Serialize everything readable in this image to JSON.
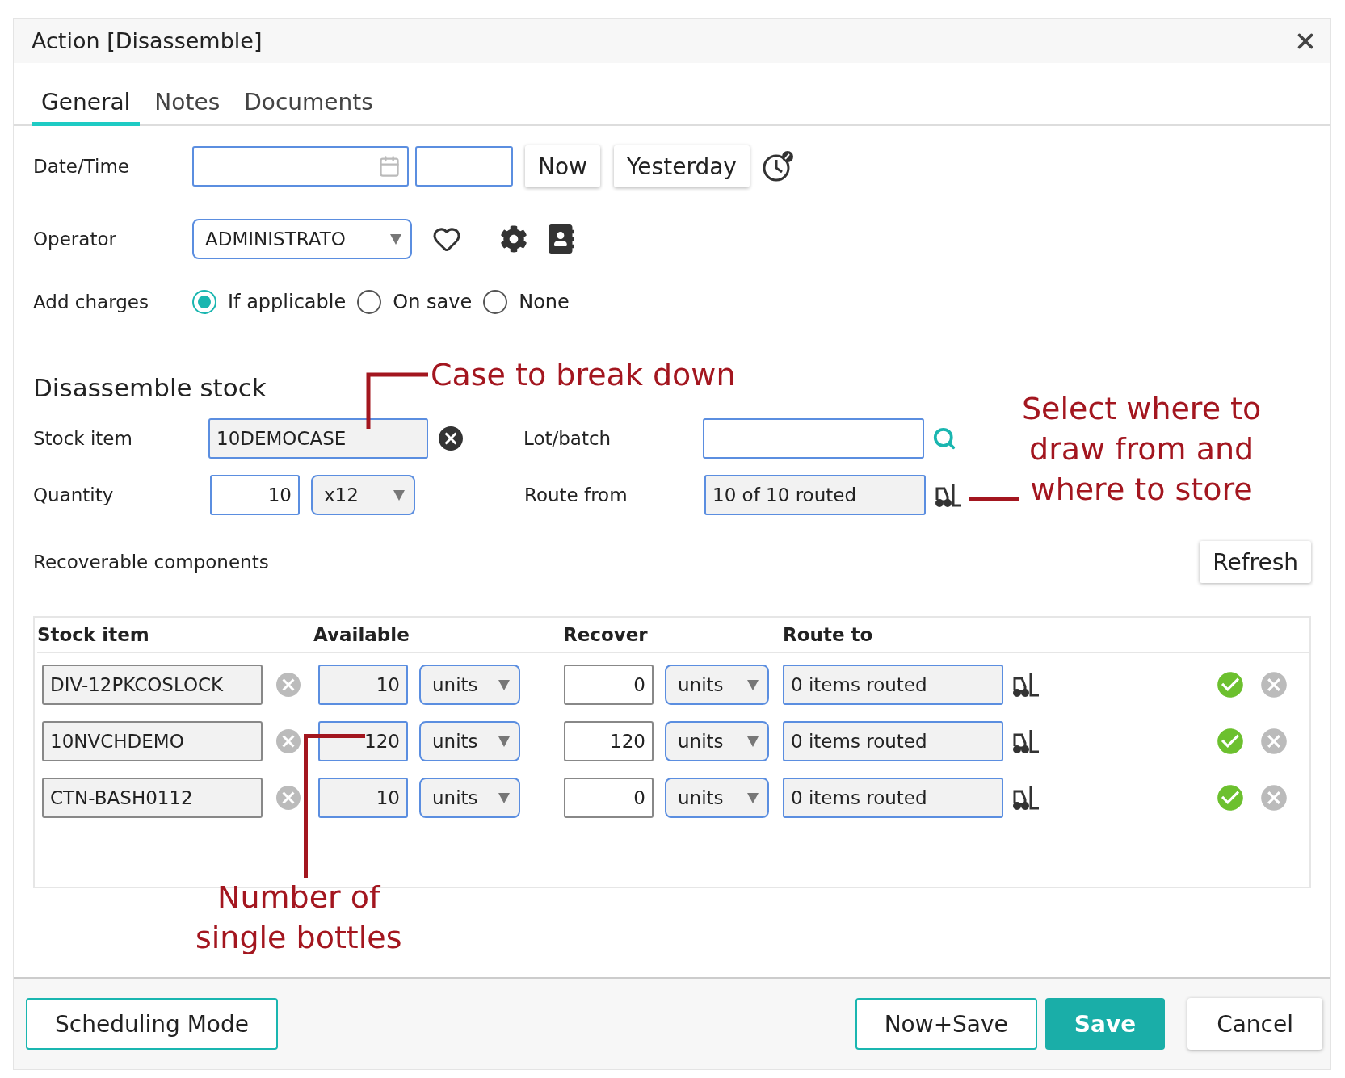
{
  "dialog": {
    "title": "Action [Disassemble]"
  },
  "tabs": [
    {
      "label": "General",
      "selected": true
    },
    {
      "label": "Notes",
      "selected": false
    },
    {
      "label": "Documents",
      "selected": false
    }
  ],
  "datetime": {
    "label": "Date/Time",
    "buttons": [
      "Now",
      "Yesterday"
    ]
  },
  "operator": {
    "label": "Operator",
    "value": "ADMINISTRATO"
  },
  "add_charges": {
    "label": "Add charges",
    "options": [
      {
        "label": "If applicable",
        "selected": true
      },
      {
        "label": "On save",
        "selected": false
      },
      {
        "label": "None",
        "selected": false
      }
    ]
  },
  "disassemble": {
    "heading": "Disassemble stock",
    "stock_item": {
      "label": "Stock item",
      "value": "10DEMOCASE"
    },
    "lot_batch": {
      "label": "Lot/batch"
    },
    "quantity": {
      "label": "Quantity",
      "value": "10",
      "unit": "x12"
    },
    "route_from": {
      "label": "Route from",
      "value": "10 of 10 routed"
    }
  },
  "components": {
    "title": "Recoverable components",
    "refresh": "Refresh",
    "columns": [
      "Stock item",
      "Available",
      "Recover",
      "Route to"
    ],
    "rows": [
      {
        "item": "DIV-12PKCOSLOCK",
        "available": "10",
        "available_unit": "units",
        "recover": "0",
        "recover_unit": "units",
        "route": "0 items routed"
      },
      {
        "item": "10NVCHDEMO",
        "available": "120",
        "available_unit": "units",
        "recover": "120",
        "recover_unit": "units",
        "route": "0 items routed"
      },
      {
        "item": "CTN-BASH0112",
        "available": "10",
        "available_unit": "units",
        "recover": "0",
        "recover_unit": "units",
        "route": "0 items routed"
      }
    ]
  },
  "footer": {
    "buttons": [
      {
        "label": "Scheduling Mode",
        "kind": "outline"
      },
      {
        "label": "Now+Save",
        "kind": "outline"
      },
      {
        "label": "Save",
        "kind": "primary"
      },
      {
        "label": "Cancel",
        "kind": "plain"
      }
    ]
  },
  "annotations": [
    {
      "lines": [
        "Case to break down"
      ]
    },
    {
      "lines": [
        "Select where to",
        "draw from and",
        "where to store"
      ]
    },
    {
      "lines": [
        "Number of",
        "single bottles"
      ]
    }
  ]
}
